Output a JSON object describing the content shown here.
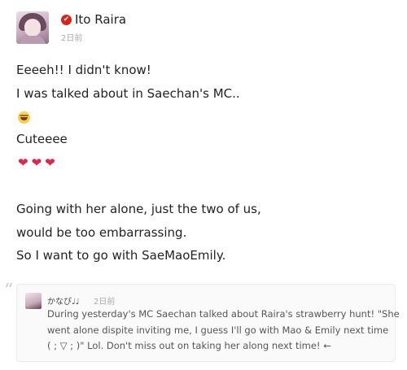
{
  "post": {
    "author": "Ito Raira",
    "time": "2日前",
    "lines": [
      "Eeeeh!! I didn't know!",
      "I was talked about in Saechan's MC..",
      "Cuteeee",
      "Going with her alone, just the two of us,",
      "would be too embarrassing.",
      "So I want to go with SaeMaoEmily."
    ],
    "hearts": [
      "❤",
      "❤",
      "❤"
    ]
  },
  "quote": {
    "mark": "“",
    "author": "かなぴ♩♩",
    "time": "2日前",
    "lines": [
      "During yesterday's MC Saechan talked about Raira's strawberry hunt! \"She",
      "went alone dispite inviting me, I guess I'll go with Mao & Emily next time",
      "( ; ▽ ; )\" Lol. Don't miss out on taking her along next time! ←"
    ]
  },
  "icons": {
    "verified": "✔",
    "verified_color": "#d9221c",
    "heart_color": "#e0244a"
  }
}
